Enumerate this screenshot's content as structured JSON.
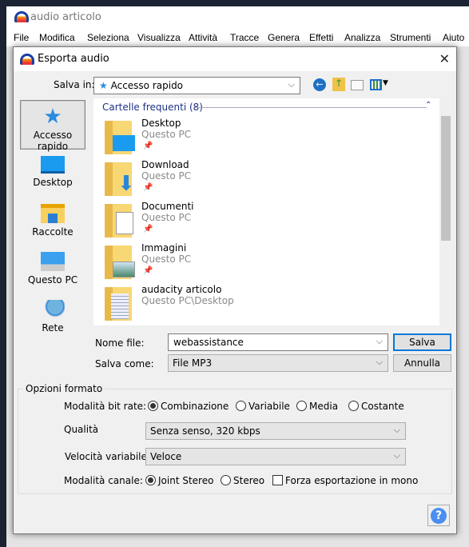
{
  "app": {
    "title": "audio articolo",
    "menu": [
      "File",
      "Modifica",
      "Seleziona",
      "Visualizza",
      "Attività",
      "Tracce",
      "Genera",
      "Effetti",
      "Analizza",
      "Strumenti",
      "Aiuto"
    ]
  },
  "dialog": {
    "title": "Esporta audio",
    "save_in_label": "Salva in:",
    "save_in_value": "Accesso rapido",
    "toolbar_icons": [
      "back-icon",
      "up-folder-icon",
      "new-folder-icon",
      "view-menu-icon"
    ],
    "places": [
      {
        "label": "Accesso rapido",
        "icon": "star-icon",
        "selected": true
      },
      {
        "label": "Desktop",
        "icon": "desktop-icon"
      },
      {
        "label": "Raccolte",
        "icon": "libraries-icon"
      },
      {
        "label": "Questo PC",
        "icon": "computer-icon"
      },
      {
        "label": "Rete",
        "icon": "network-icon"
      }
    ],
    "list_header": "Cartelle frequenti (8)",
    "items": [
      {
        "name": "Desktop",
        "location": "Questo PC",
        "pinned": true
      },
      {
        "name": "Download",
        "location": "Questo PC",
        "pinned": true
      },
      {
        "name": "Documenti",
        "location": "Questo PC",
        "pinned": true
      },
      {
        "name": "Immagini",
        "location": "Questo PC",
        "pinned": true
      },
      {
        "name": "audacity articolo",
        "location": "Questo PC\\Desktop",
        "pinned": false
      }
    ],
    "filename_label": "Nome file:",
    "filename_value": "webassistance",
    "filetype_label": "Salva come:",
    "filetype_value": "File MP3",
    "save_button": "Salva",
    "cancel_button": "Annulla",
    "options": {
      "title": "Opzioni formato",
      "bitrate_label": "Modalità bit rate:",
      "bitrate_options": [
        "Combinazione",
        "Variabile",
        "Media",
        "Costante"
      ],
      "bitrate_selected": "Combinazione",
      "quality_label": "Qualità",
      "quality_value": "Senza senso, 320 kbps",
      "vbr_label": "Velocità variabile:",
      "vbr_value": "Veloce",
      "channel_label": "Modalità canale:",
      "channel_options": [
        "Joint Stereo",
        "Stereo"
      ],
      "channel_selected": "Joint Stereo",
      "mono_label": "Forza esportazione in mono",
      "mono_checked": false
    },
    "help_label": "?"
  }
}
